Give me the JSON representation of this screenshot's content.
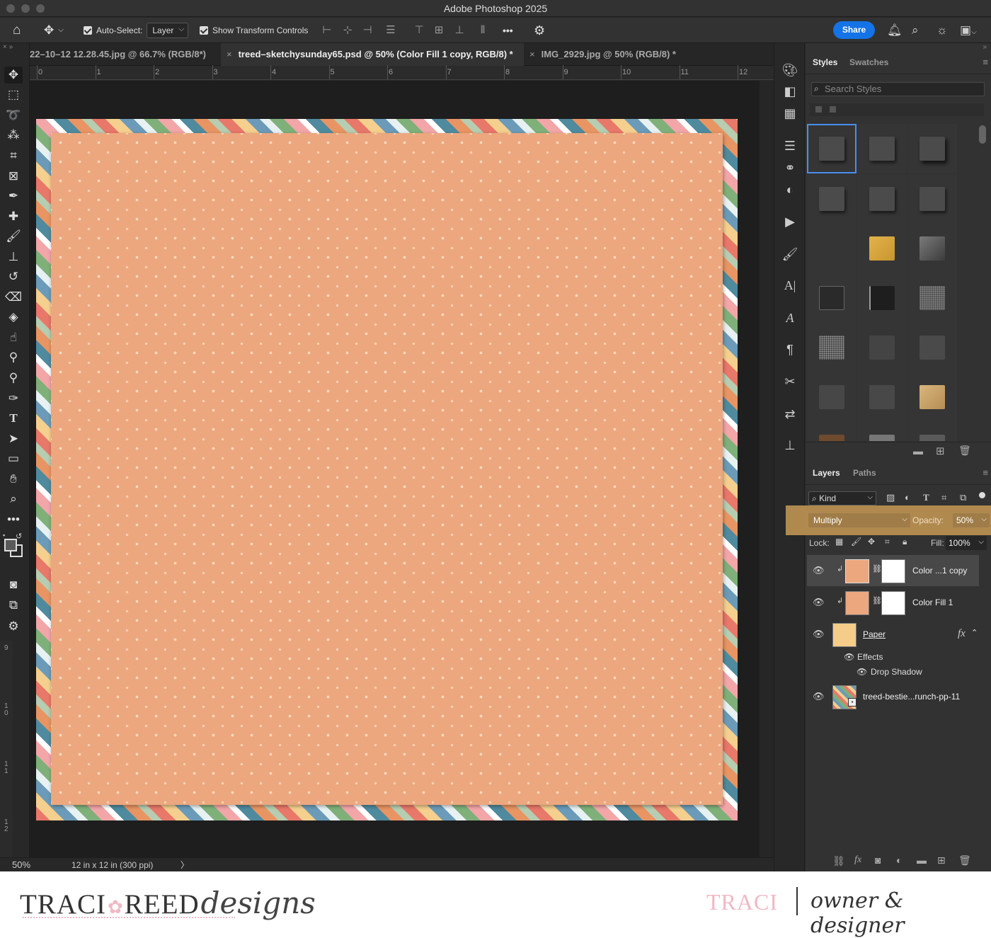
{
  "app": {
    "title": "Adobe Photoshop 2025"
  },
  "options_bar": {
    "auto_select_label": "Auto-Select:",
    "auto_select_value": "Layer",
    "show_transform_label": "Show Transform Controls",
    "more_label": "•••",
    "share_label": "Share"
  },
  "tabs": [
    {
      "label": "22–10–12 12.28.45.jpg @ 66.7% (RGB/8*)"
    },
    {
      "label": "treed–sketchysunday65.psd @ 50% (Color Fill 1 copy, RGB/8) *"
    },
    {
      "label": "IMG_2929.jpg @ 50% (RGB/8) *"
    }
  ],
  "ruler": {
    "marks": [
      "0",
      "1",
      "2",
      "3",
      "4",
      "5",
      "6",
      "7",
      "8",
      "9",
      "10",
      "11",
      "12"
    ],
    "vertical": [
      "9",
      "1\n0",
      "1\n1",
      "1\n2"
    ]
  },
  "status": {
    "zoom": "50%",
    "doc_size": "12 in x 12 in (300 ppi)",
    "arrow": "〉"
  },
  "styles_panel": {
    "tabs": [
      {
        "label": "Styles"
      },
      {
        "label": "Swatches"
      }
    ],
    "search_placeholder": "Search Styles"
  },
  "layers_panel": {
    "tabs": [
      {
        "label": "Layers"
      },
      {
        "label": "Paths"
      }
    ],
    "filter_kind": "Kind",
    "blend_mode": "Multiply",
    "opacity_label": "Opacity:",
    "opacity_value": "50%",
    "lock_label": "Lock:",
    "fill_label": "Fill:",
    "fill_value": "100%",
    "layers": [
      {
        "name": "Color ...1 copy"
      },
      {
        "name": "Color Fill 1"
      },
      {
        "name": "Paper",
        "fx": "fx"
      },
      {
        "name": "treed-bestie...runch-pp-11"
      }
    ],
    "effects_label": "Effects",
    "drop_shadow_label": "Drop Shadow"
  },
  "footer": {
    "brand_left": "TRACI",
    "brand_right": "REED",
    "brand_script": "designs",
    "author": "TRACI",
    "role": "owner & designer"
  },
  "colors": {
    "paper": "#eca77e",
    "accent": "#1473e6",
    "blend_highlight": "#b0894f",
    "brand_pink": "#f0b8c4"
  }
}
